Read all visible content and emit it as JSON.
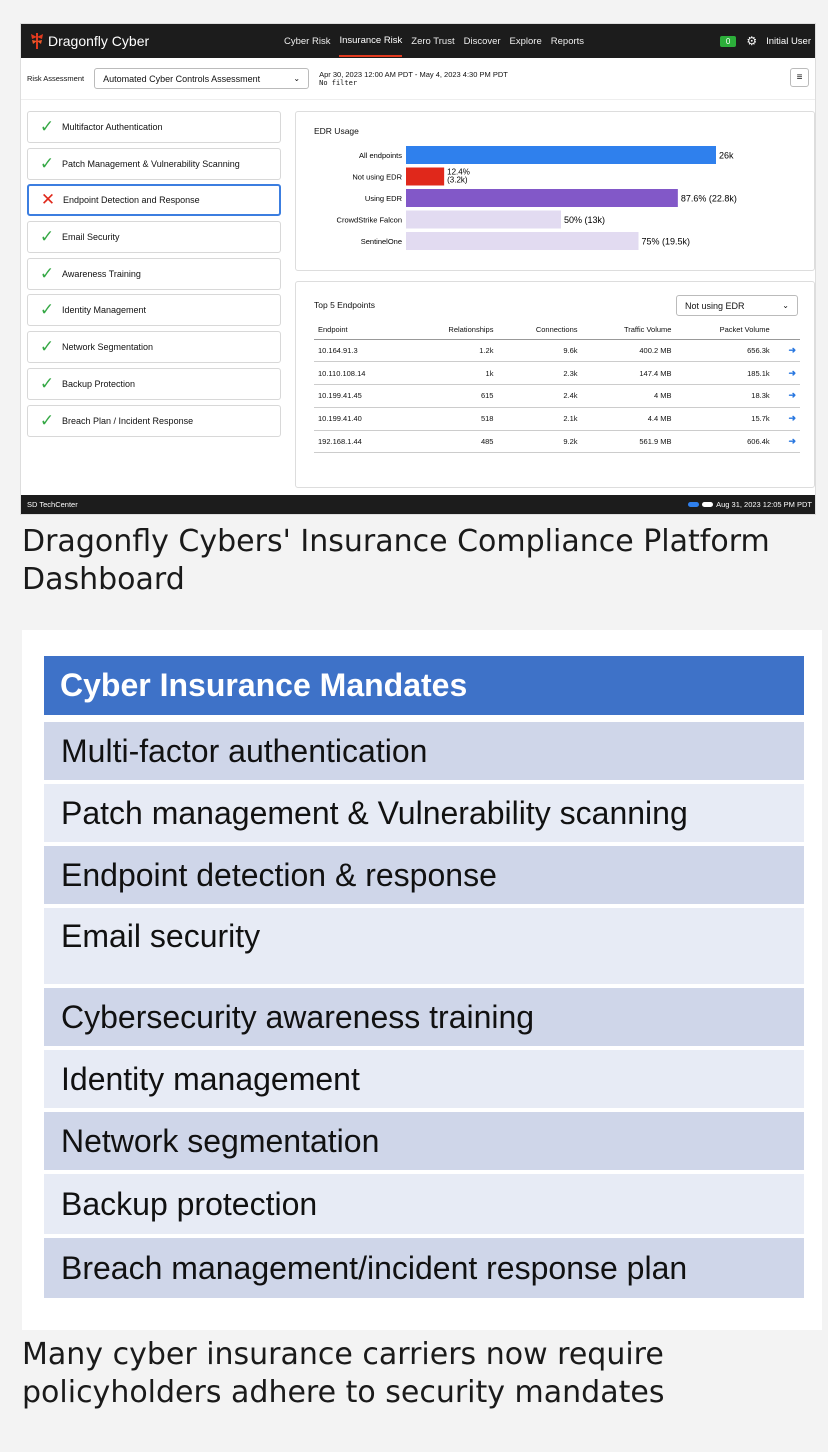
{
  "app": {
    "brand": "Dragonfly Cyber",
    "nav": [
      "Cyber Risk",
      "Insurance Risk",
      "Zero Trust",
      "Discover",
      "Explore",
      "Reports"
    ],
    "nav_active": "Insurance Risk",
    "badge": "0",
    "user": "Initial User",
    "filter": {
      "label": "Risk Assessment",
      "assessment": "Automated Cyber Controls Assessment",
      "date_range": "Apr 30, 2023 12:00 AM PDT - May 4, 2023 4:30 PM PDT",
      "filter_text": "No filter"
    },
    "controls": [
      {
        "label": "Multifactor Authentication",
        "status": "pass"
      },
      {
        "label": "Patch Management & Vulnerability Scanning",
        "status": "pass"
      },
      {
        "label": "Endpoint Detection and Response",
        "status": "fail"
      },
      {
        "label": "Email Security",
        "status": "pass"
      },
      {
        "label": "Awareness Training",
        "status": "pass"
      },
      {
        "label": "Identity Management",
        "status": "pass"
      },
      {
        "label": "Network Segmentation",
        "status": "pass"
      },
      {
        "label": "Backup Protection",
        "status": "pass"
      },
      {
        "label": "Breach Plan / Incident Response",
        "status": "pass"
      }
    ],
    "top5": {
      "title": "Top 5 Endpoints",
      "filter": "Not using EDR",
      "columns": [
        "Endpoint",
        "Relationships",
        "Connections",
        "Traffic Volume",
        "Packet Volume"
      ],
      "rows": [
        [
          "10.164.91.3",
          "1.2k",
          "9.6k",
          "400.2 MB",
          "656.3k"
        ],
        [
          "10.110.108.14",
          "1k",
          "2.3k",
          "147.4 MB",
          "185.1k"
        ],
        [
          "10.199.41.45",
          "615",
          "2.4k",
          "4 MB",
          "18.3k"
        ],
        [
          "10.199.41.40",
          "518",
          "2.1k",
          "4.4 MB",
          "15.7k"
        ],
        [
          "192.168.1.44",
          "485",
          "9.2k",
          "561.9 MB",
          "606.4k"
        ]
      ]
    },
    "status": {
      "left": "SD TechCenter",
      "right": "Aug 31, 2023 12:05 PM PDT"
    }
  },
  "chart_data": {
    "type": "bar",
    "orientation": "horizontal",
    "title": "EDR Usage",
    "categories": [
      "All endpoints",
      "Not using EDR",
      "Using EDR",
      "CrowdStrike Falcon",
      "SentinelOne"
    ],
    "values": [
      26000,
      3200,
      22800,
      13000,
      19500
    ],
    "labels": [
      "26k",
      "12.4%\n(3.2k)",
      "87.6% (22.8k)",
      "50% (13k)",
      "75% (19.5k)"
    ],
    "colors": [
      "#2f80ed",
      "#e0281b",
      "#8258c8",
      "#e2dbf1",
      "#e2dbf1"
    ],
    "xlim": [
      0,
      26000
    ]
  },
  "captions": {
    "first": "Dragonfly Cybers' Insurance Compliance Platform Dashboard",
    "second": "Many cyber insurance carriers now require policyholders adhere to security mandates"
  },
  "mandates": {
    "header": "Cyber Insurance Mandates",
    "items": [
      "Multi-factor authentication",
      "Patch management & Vulnerability scanning",
      "Endpoint detection & response",
      "Email security",
      "Cybersecurity awareness training",
      "Identity management",
      "Network segmentation",
      "Backup protection",
      "Breach management/incident response plan"
    ],
    "row_colors": [
      "#cfd6e9",
      "#e7ebf5",
      "#cfd6e9",
      "#e7ebf5",
      "#cfd6e9",
      "#e7ebf5",
      "#cfd6e9",
      "#e7ebf5",
      "#cfd6e9"
    ]
  }
}
